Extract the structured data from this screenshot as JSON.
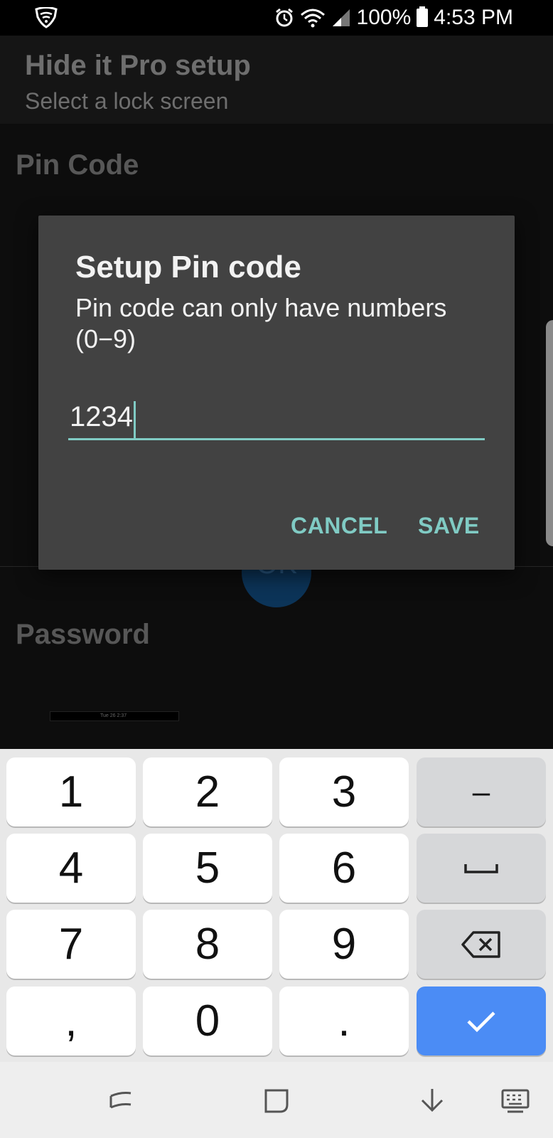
{
  "status_bar": {
    "battery_percent": "100%",
    "time": "4:53 PM",
    "icons": [
      "shield-icon",
      "alarm-icon",
      "wifi-icon",
      "signal-icon",
      "battery-icon"
    ]
  },
  "header": {
    "title": "Hide it Pro setup",
    "subtitle": "Select a lock screen"
  },
  "background": {
    "section_pin": "Pin Code",
    "section_password": "Password",
    "ok_button": "OK",
    "thumbnail_time": "Tue 26 2:37"
  },
  "dialog": {
    "title": "Setup Pin code",
    "message": "Pin code can only have numbers (0−9)",
    "input_value": "1234",
    "cancel_label": "CANCEL",
    "save_label": "SAVE",
    "accent_color": "#80cbc4"
  },
  "keyboard": {
    "keys": [
      [
        "1",
        "2",
        "3",
        "–"
      ],
      [
        "4",
        "5",
        "6",
        "space"
      ],
      [
        "7",
        "8",
        "9",
        "backspace"
      ],
      [
        ",",
        "0",
        ".",
        "done"
      ]
    ],
    "enter_color": "#4b8cf5"
  },
  "nav_bar": {
    "icons": [
      "recent-apps-icon",
      "home-icon",
      "hide-keyboard-icon",
      "keyboard-switch-icon"
    ]
  }
}
